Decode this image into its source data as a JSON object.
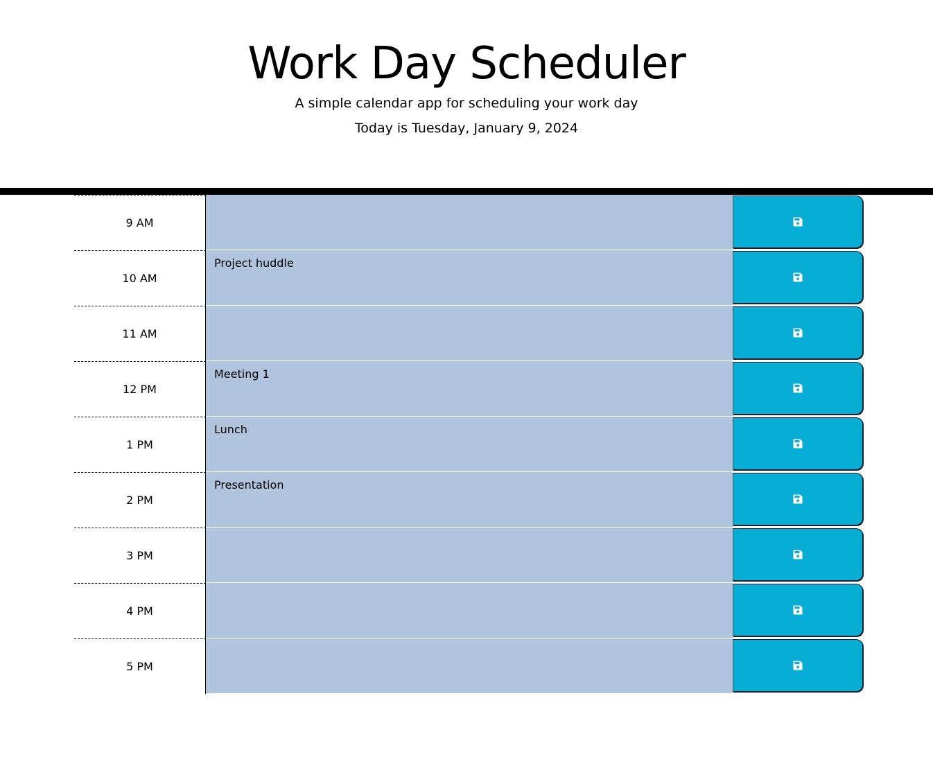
{
  "header": {
    "title": "Work Day Scheduler",
    "subtitle": "A simple calendar app for scheduling your work day",
    "today": "Today is Tuesday, January 9, 2024"
  },
  "colors": {
    "row_background": "#b0c4de",
    "save_button": "#06aed5",
    "divider": "#000000"
  },
  "save_icon": "floppy-disk-icon",
  "rows": [
    {
      "hour": "9 AM",
      "text": ""
    },
    {
      "hour": "10 AM",
      "text": "Project huddle"
    },
    {
      "hour": "11 AM",
      "text": ""
    },
    {
      "hour": "12 PM",
      "text": "Meeting 1"
    },
    {
      "hour": "1 PM",
      "text": "Lunch"
    },
    {
      "hour": "2 PM",
      "text": "Presentation"
    },
    {
      "hour": "3 PM",
      "text": ""
    },
    {
      "hour": "4 PM",
      "text": ""
    },
    {
      "hour": "5 PM",
      "text": ""
    }
  ]
}
